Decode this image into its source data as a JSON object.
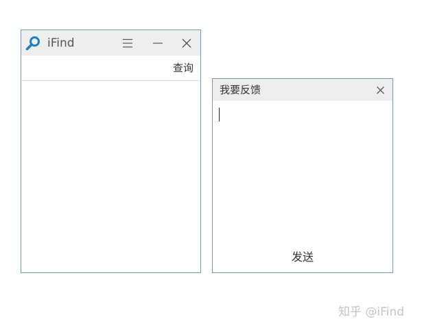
{
  "main_window": {
    "title": "iFind",
    "toolbar": {
      "query_label": "查询"
    }
  },
  "feedback": {
    "title": "我要反馈",
    "input_value": "",
    "send_label": "发送"
  },
  "watermark": {
    "text": "知乎 @iFind"
  },
  "icons": {
    "app": "search-magnifier-icon",
    "menu": "hamburger-menu-icon",
    "minimize": "minimize-icon",
    "close": "close-icon"
  },
  "colors": {
    "window_border": "#7f99a6",
    "titlebar_bg": "#eeeeee",
    "accent_icon": "#1a7fc1",
    "watermark": "#c4c4c4"
  }
}
